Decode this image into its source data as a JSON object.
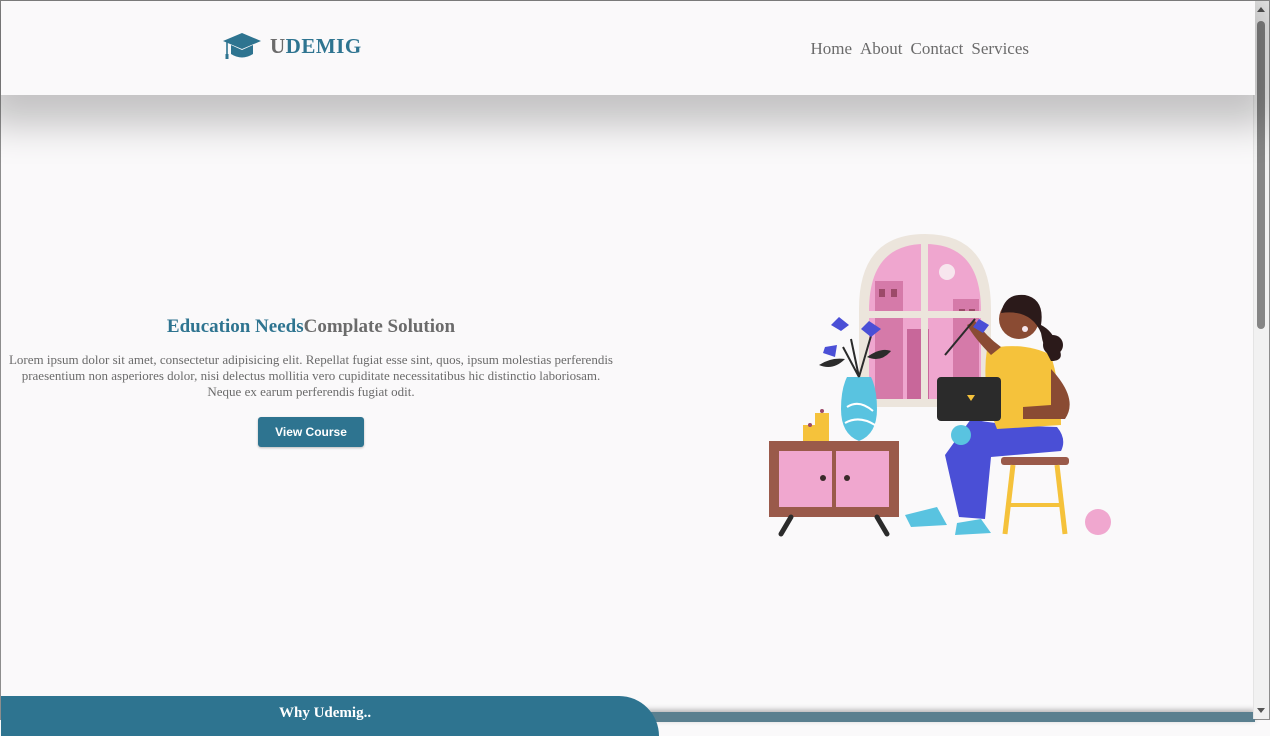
{
  "header": {
    "logo_icon": "graduation-cap-icon",
    "logo_first_letter": "U",
    "logo_rest": "DEMIG",
    "nav": [
      "Home",
      "About",
      "Contact",
      "Services"
    ]
  },
  "hero": {
    "title_part1": "Education Needs",
    "title_part2": "Complate Solution",
    "paragraph": "Lorem ipsum dolor sit amet, consectetur adipisicing elit. Repellat fugiat esse sint, quos, ipsum molestias perferendis praesentium non asperiores dolor, nisi delectus mollitia vero cupiditate necessitatibus hic distinctio laboriosam. Neque ex earum perferendis fugiat odit.",
    "button_label": "View Course",
    "illustration": "woman-with-laptop-illustration"
  },
  "section": {
    "why_label": "Why Udemig.."
  },
  "colors": {
    "brand": "#2e7490",
    "text_gray": "#6b6b6b",
    "background": "#faf9fa"
  }
}
